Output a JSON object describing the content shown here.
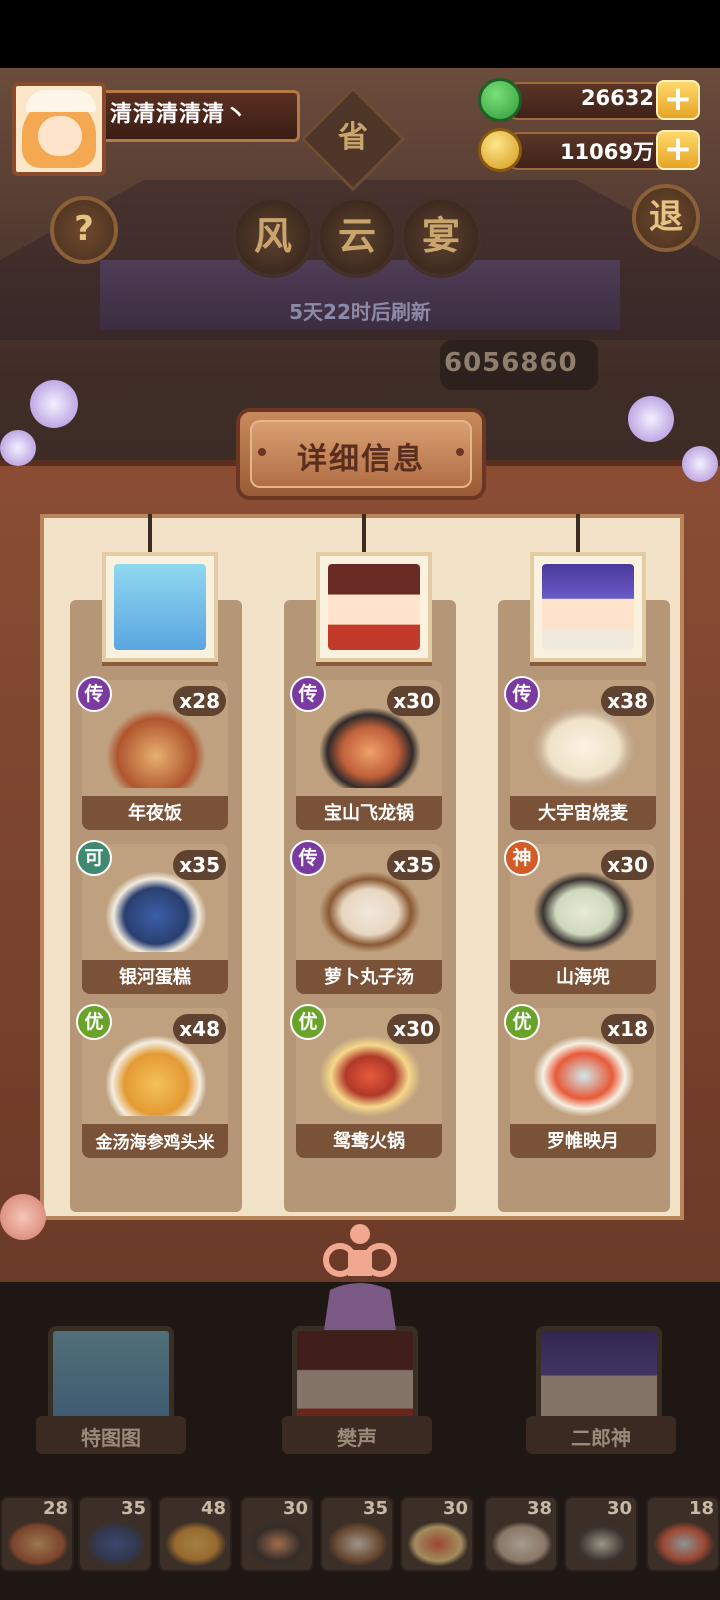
{
  "player": {
    "name": "清清清清清丶"
  },
  "currency": {
    "jade": "26632",
    "coins": "11069万"
  },
  "buttons": {
    "help": "?",
    "exit": "退",
    "plus": "+"
  },
  "event": {
    "province": "省",
    "title_chars": [
      "风",
      "云",
      "宴"
    ],
    "refresh": "5天22时后刷新",
    "score": "6056860"
  },
  "panel": {
    "title": "详细信息"
  },
  "columns": [
    {
      "chef": "特图图",
      "dishes": [
        {
          "name": "年夜饭",
          "qty": "x28",
          "rank": "传",
          "rank_type": "legend"
        },
        {
          "name": "银河蛋糕",
          "qty": "x35",
          "rank": "可",
          "rank_type": "ok"
        },
        {
          "name": "金汤海参鸡头米",
          "qty": "x48",
          "rank": "优",
          "rank_type": "good"
        }
      ]
    },
    {
      "chef": "樊声",
      "dishes": [
        {
          "name": "宝山飞龙锅",
          "qty": "x30",
          "rank": "传",
          "rank_type": "legend"
        },
        {
          "name": "萝卜丸子汤",
          "qty": "x35",
          "rank": "传",
          "rank_type": "legend"
        },
        {
          "name": "鸳鸯火锅",
          "qty": "x30",
          "rank": "优",
          "rank_type": "good"
        }
      ]
    },
    {
      "chef": "二郎神",
      "dishes": [
        {
          "name": "大宇宙烧麦",
          "qty": "x38",
          "rank": "传",
          "rank_type": "legend"
        },
        {
          "name": "山海兜",
          "qty": "x30",
          "rank": "神",
          "rank_type": "god"
        },
        {
          "name": "罗帷映月",
          "qty": "x18",
          "rank": "优",
          "rank_type": "good"
        }
      ]
    }
  ],
  "bottom_slots": [
    "28",
    "35",
    "48",
    "30",
    "35",
    "30",
    "38",
    "30",
    "18"
  ],
  "colors": {
    "legend": "#7a3aa0",
    "god": "#d45a26",
    "ok": "#3f8a6e",
    "good": "#6aa32a",
    "board": "#f1e2c8"
  }
}
